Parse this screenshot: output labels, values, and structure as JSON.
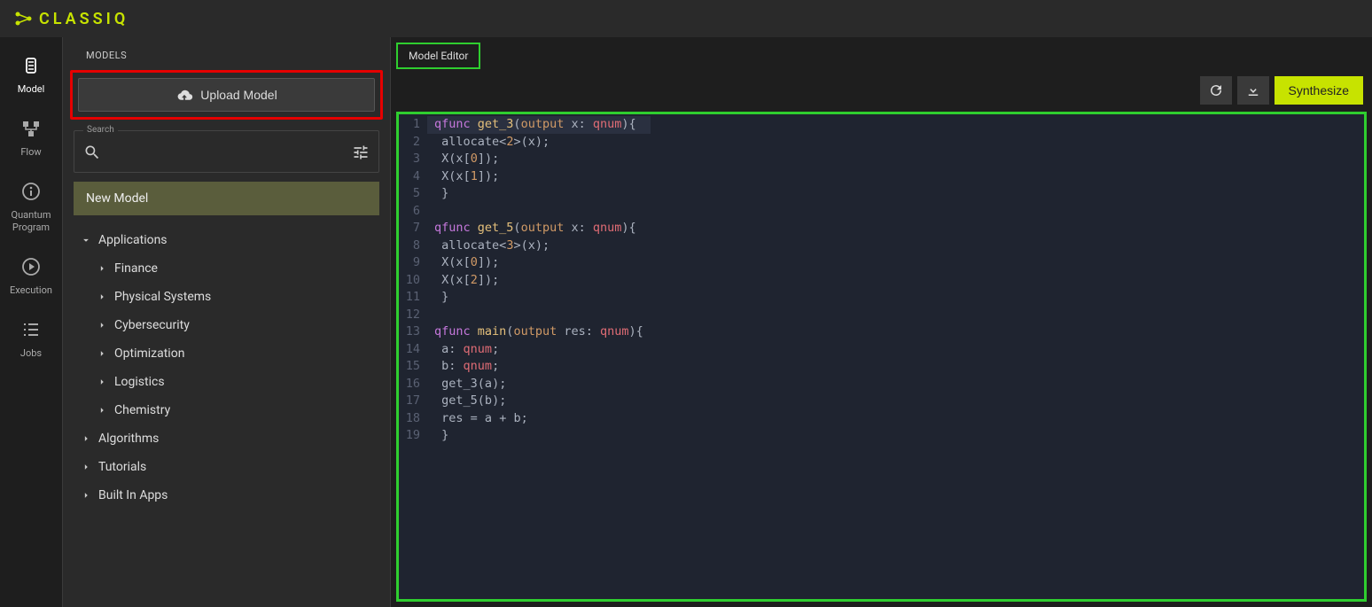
{
  "brand": "CLASSIQ",
  "side_nav": [
    {
      "label": "Model",
      "icon": "model-icon",
      "active": true
    },
    {
      "label": "Flow",
      "icon": "flow-icon",
      "active": false
    },
    {
      "label": "Quantum\nProgram",
      "icon": "info-icon",
      "active": false
    },
    {
      "label": "Execution",
      "icon": "play-icon",
      "active": false
    },
    {
      "label": "Jobs",
      "icon": "list-icon",
      "active": false
    }
  ],
  "panel": {
    "header": "MODELS",
    "upload_label": "Upload Model",
    "search_label": "Search",
    "new_model_label": "New Model",
    "tree": [
      {
        "label": "Applications",
        "level": 1,
        "expanded": true,
        "children": [
          {
            "label": "Finance"
          },
          {
            "label": "Physical Systems"
          },
          {
            "label": "Cybersecurity"
          },
          {
            "label": "Optimization"
          },
          {
            "label": "Logistics"
          },
          {
            "label": "Chemistry"
          }
        ]
      },
      {
        "label": "Algorithms",
        "level": 1,
        "expanded": false
      },
      {
        "label": "Tutorials",
        "level": 1,
        "expanded": false
      },
      {
        "label": "Built In Apps",
        "level": 1,
        "expanded": false
      }
    ]
  },
  "editor": {
    "tab_label": "Model Editor",
    "synthesize_label": "Synthesize",
    "code_lines": [
      {
        "n": 1,
        "hl": true,
        "tokens": [
          [
            "kw",
            "qfunc"
          ],
          [
            "sp",
            " "
          ],
          [
            "fn",
            "get_3"
          ],
          [
            "punc",
            "("
          ],
          [
            "param",
            "output"
          ],
          [
            "sp",
            " "
          ],
          [
            "id",
            "x"
          ],
          [
            "punc",
            ": "
          ],
          [
            "type",
            "qnum"
          ],
          [
            "punc",
            "){"
          ]
        ]
      },
      {
        "n": 2,
        "hl": false,
        "tokens": [
          [
            "sp",
            " "
          ],
          [
            "id",
            "allocate"
          ],
          [
            "punc",
            "<"
          ],
          [
            "num",
            "2"
          ],
          [
            "punc",
            ">("
          ],
          [
            "id",
            "x"
          ],
          [
            "punc",
            ");"
          ]
        ]
      },
      {
        "n": 3,
        "hl": false,
        "tokens": [
          [
            "sp",
            " "
          ],
          [
            "id",
            "X"
          ],
          [
            "punc",
            "("
          ],
          [
            "id",
            "x"
          ],
          [
            "punc",
            "["
          ],
          [
            "num",
            "0"
          ],
          [
            "punc",
            "]);"
          ]
        ]
      },
      {
        "n": 4,
        "hl": false,
        "tokens": [
          [
            "sp",
            " "
          ],
          [
            "id",
            "X"
          ],
          [
            "punc",
            "("
          ],
          [
            "id",
            "x"
          ],
          [
            "punc",
            "["
          ],
          [
            "num",
            "1"
          ],
          [
            "punc",
            "]);"
          ]
        ]
      },
      {
        "n": 5,
        "hl": false,
        "tokens": [
          [
            "sp",
            " "
          ],
          [
            "punc",
            "}"
          ]
        ]
      },
      {
        "n": 6,
        "hl": false,
        "tokens": []
      },
      {
        "n": 7,
        "hl": false,
        "tokens": [
          [
            "kw",
            "qfunc"
          ],
          [
            "sp",
            " "
          ],
          [
            "fn",
            "get_5"
          ],
          [
            "punc",
            "("
          ],
          [
            "param",
            "output"
          ],
          [
            "sp",
            " "
          ],
          [
            "id",
            "x"
          ],
          [
            "punc",
            ": "
          ],
          [
            "type",
            "qnum"
          ],
          [
            "punc",
            "){"
          ]
        ]
      },
      {
        "n": 8,
        "hl": false,
        "tokens": [
          [
            "sp",
            " "
          ],
          [
            "id",
            "allocate"
          ],
          [
            "punc",
            "<"
          ],
          [
            "num",
            "3"
          ],
          [
            "punc",
            ">("
          ],
          [
            "id",
            "x"
          ],
          [
            "punc",
            ");"
          ]
        ]
      },
      {
        "n": 9,
        "hl": false,
        "tokens": [
          [
            "sp",
            " "
          ],
          [
            "id",
            "X"
          ],
          [
            "punc",
            "("
          ],
          [
            "id",
            "x"
          ],
          [
            "punc",
            "["
          ],
          [
            "num",
            "0"
          ],
          [
            "punc",
            "]);"
          ]
        ]
      },
      {
        "n": 10,
        "hl": false,
        "tokens": [
          [
            "sp",
            " "
          ],
          [
            "id",
            "X"
          ],
          [
            "punc",
            "("
          ],
          [
            "id",
            "x"
          ],
          [
            "punc",
            "["
          ],
          [
            "num",
            "2"
          ],
          [
            "punc",
            "]);"
          ]
        ]
      },
      {
        "n": 11,
        "hl": false,
        "tokens": [
          [
            "sp",
            " "
          ],
          [
            "punc",
            "}"
          ]
        ]
      },
      {
        "n": 12,
        "hl": false,
        "tokens": []
      },
      {
        "n": 13,
        "hl": false,
        "tokens": [
          [
            "kw",
            "qfunc"
          ],
          [
            "sp",
            " "
          ],
          [
            "fn",
            "main"
          ],
          [
            "punc",
            "("
          ],
          [
            "param",
            "output"
          ],
          [
            "sp",
            " "
          ],
          [
            "id",
            "res"
          ],
          [
            "punc",
            ": "
          ],
          [
            "type",
            "qnum"
          ],
          [
            "punc",
            "){"
          ]
        ]
      },
      {
        "n": 14,
        "hl": false,
        "tokens": [
          [
            "sp",
            " "
          ],
          [
            "id",
            "a"
          ],
          [
            "punc",
            ": "
          ],
          [
            "type",
            "qnum"
          ],
          [
            "punc",
            ";"
          ]
        ]
      },
      {
        "n": 15,
        "hl": false,
        "tokens": [
          [
            "sp",
            " "
          ],
          [
            "id",
            "b"
          ],
          [
            "punc",
            ": "
          ],
          [
            "type",
            "qnum"
          ],
          [
            "punc",
            ";"
          ]
        ]
      },
      {
        "n": 16,
        "hl": false,
        "tokens": [
          [
            "sp",
            " "
          ],
          [
            "id",
            "get_3"
          ],
          [
            "punc",
            "("
          ],
          [
            "id",
            "a"
          ],
          [
            "punc",
            ");"
          ]
        ]
      },
      {
        "n": 17,
        "hl": false,
        "tokens": [
          [
            "sp",
            " "
          ],
          [
            "id",
            "get_5"
          ],
          [
            "punc",
            "("
          ],
          [
            "id",
            "b"
          ],
          [
            "punc",
            ");"
          ]
        ]
      },
      {
        "n": 18,
        "hl": false,
        "tokens": [
          [
            "sp",
            " "
          ],
          [
            "id",
            "res"
          ],
          [
            "punc",
            " = "
          ],
          [
            "id",
            "a"
          ],
          [
            "punc",
            " + "
          ],
          [
            "id",
            "b"
          ],
          [
            "punc",
            ";"
          ]
        ]
      },
      {
        "n": 19,
        "hl": false,
        "tokens": [
          [
            "sp",
            " "
          ],
          [
            "punc",
            "}"
          ]
        ]
      }
    ]
  }
}
